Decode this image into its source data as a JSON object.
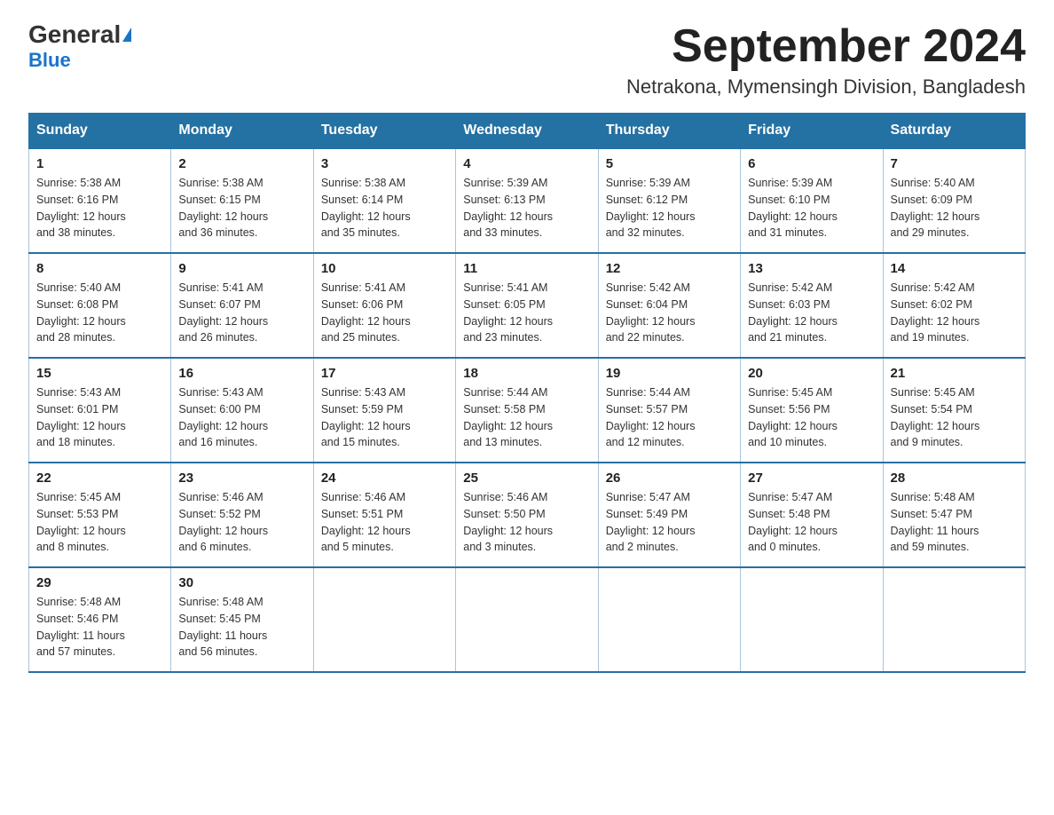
{
  "header": {
    "logo_general": "General",
    "logo_blue": "Blue",
    "month_title": "September 2024",
    "location": "Netrakona, Mymensingh Division, Bangladesh"
  },
  "weekdays": [
    "Sunday",
    "Monday",
    "Tuesday",
    "Wednesday",
    "Thursday",
    "Friday",
    "Saturday"
  ],
  "weeks": [
    [
      {
        "day": "1",
        "sunrise": "5:38 AM",
        "sunset": "6:16 PM",
        "daylight": "12 hours and 38 minutes."
      },
      {
        "day": "2",
        "sunrise": "5:38 AM",
        "sunset": "6:15 PM",
        "daylight": "12 hours and 36 minutes."
      },
      {
        "day": "3",
        "sunrise": "5:38 AM",
        "sunset": "6:14 PM",
        "daylight": "12 hours and 35 minutes."
      },
      {
        "day": "4",
        "sunrise": "5:39 AM",
        "sunset": "6:13 PM",
        "daylight": "12 hours and 33 minutes."
      },
      {
        "day": "5",
        "sunrise": "5:39 AM",
        "sunset": "6:12 PM",
        "daylight": "12 hours and 32 minutes."
      },
      {
        "day": "6",
        "sunrise": "5:39 AM",
        "sunset": "6:10 PM",
        "daylight": "12 hours and 31 minutes."
      },
      {
        "day": "7",
        "sunrise": "5:40 AM",
        "sunset": "6:09 PM",
        "daylight": "12 hours and 29 minutes."
      }
    ],
    [
      {
        "day": "8",
        "sunrise": "5:40 AM",
        "sunset": "6:08 PM",
        "daylight": "12 hours and 28 minutes."
      },
      {
        "day": "9",
        "sunrise": "5:41 AM",
        "sunset": "6:07 PM",
        "daylight": "12 hours and 26 minutes."
      },
      {
        "day": "10",
        "sunrise": "5:41 AM",
        "sunset": "6:06 PM",
        "daylight": "12 hours and 25 minutes."
      },
      {
        "day": "11",
        "sunrise": "5:41 AM",
        "sunset": "6:05 PM",
        "daylight": "12 hours and 23 minutes."
      },
      {
        "day": "12",
        "sunrise": "5:42 AM",
        "sunset": "6:04 PM",
        "daylight": "12 hours and 22 minutes."
      },
      {
        "day": "13",
        "sunrise": "5:42 AM",
        "sunset": "6:03 PM",
        "daylight": "12 hours and 21 minutes."
      },
      {
        "day": "14",
        "sunrise": "5:42 AM",
        "sunset": "6:02 PM",
        "daylight": "12 hours and 19 minutes."
      }
    ],
    [
      {
        "day": "15",
        "sunrise": "5:43 AM",
        "sunset": "6:01 PM",
        "daylight": "12 hours and 18 minutes."
      },
      {
        "day": "16",
        "sunrise": "5:43 AM",
        "sunset": "6:00 PM",
        "daylight": "12 hours and 16 minutes."
      },
      {
        "day": "17",
        "sunrise": "5:43 AM",
        "sunset": "5:59 PM",
        "daylight": "12 hours and 15 minutes."
      },
      {
        "day": "18",
        "sunrise": "5:44 AM",
        "sunset": "5:58 PM",
        "daylight": "12 hours and 13 minutes."
      },
      {
        "day": "19",
        "sunrise": "5:44 AM",
        "sunset": "5:57 PM",
        "daylight": "12 hours and 12 minutes."
      },
      {
        "day": "20",
        "sunrise": "5:45 AM",
        "sunset": "5:56 PM",
        "daylight": "12 hours and 10 minutes."
      },
      {
        "day": "21",
        "sunrise": "5:45 AM",
        "sunset": "5:54 PM",
        "daylight": "12 hours and 9 minutes."
      }
    ],
    [
      {
        "day": "22",
        "sunrise": "5:45 AM",
        "sunset": "5:53 PM",
        "daylight": "12 hours and 8 minutes."
      },
      {
        "day": "23",
        "sunrise": "5:46 AM",
        "sunset": "5:52 PM",
        "daylight": "12 hours and 6 minutes."
      },
      {
        "day": "24",
        "sunrise": "5:46 AM",
        "sunset": "5:51 PM",
        "daylight": "12 hours and 5 minutes."
      },
      {
        "day": "25",
        "sunrise": "5:46 AM",
        "sunset": "5:50 PM",
        "daylight": "12 hours and 3 minutes."
      },
      {
        "day": "26",
        "sunrise": "5:47 AM",
        "sunset": "5:49 PM",
        "daylight": "12 hours and 2 minutes."
      },
      {
        "day": "27",
        "sunrise": "5:47 AM",
        "sunset": "5:48 PM",
        "daylight": "12 hours and 0 minutes."
      },
      {
        "day": "28",
        "sunrise": "5:48 AM",
        "sunset": "5:47 PM",
        "daylight": "11 hours and 59 minutes."
      }
    ],
    [
      {
        "day": "29",
        "sunrise": "5:48 AM",
        "sunset": "5:46 PM",
        "daylight": "11 hours and 57 minutes."
      },
      {
        "day": "30",
        "sunrise": "5:48 AM",
        "sunset": "5:45 PM",
        "daylight": "11 hours and 56 minutes."
      },
      null,
      null,
      null,
      null,
      null
    ]
  ],
  "labels": {
    "sunrise_label": "Sunrise:",
    "sunset_label": "Sunset:",
    "daylight_label": "Daylight:"
  }
}
